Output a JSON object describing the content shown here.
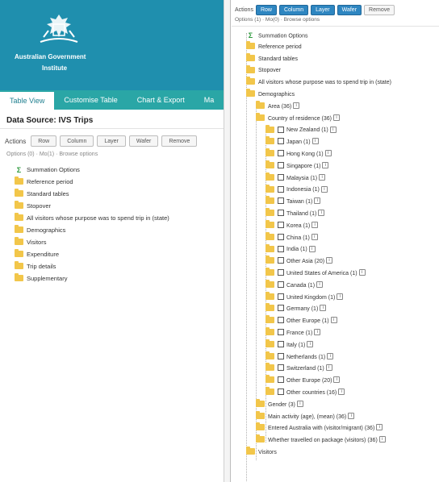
{
  "colors": {
    "banner": "#1f8fae",
    "tabbar": "#2aa6a6",
    "folder": "#f2c64a",
    "action_button": "#2e86c1"
  },
  "header": {
    "org_line1": "Australian Government",
    "org_line2": "Institute",
    "logo_icon": "coat-of-arms-icon"
  },
  "tabs": [
    {
      "label": "Table View",
      "active": true
    },
    {
      "label": "Customise Table",
      "active": false
    },
    {
      "label": "Chart & Export",
      "active": false
    },
    {
      "label": "Ma",
      "active": false
    }
  ],
  "left": {
    "data_source_title": "Data Source: IVS Trips",
    "actions_label": "Actions",
    "buttons": [
      "Row",
      "Column",
      "Layer",
      "Wafer",
      "Remove"
    ],
    "options_text": "Options (0) · Mo(1) · Browse options",
    "tree": [
      {
        "icon": "sigma-icon",
        "label": "Summation Options"
      },
      {
        "icon": "folder-icon",
        "label": "Reference period"
      },
      {
        "icon": "folder-icon",
        "label": "Standard tables"
      },
      {
        "icon": "folder-icon",
        "label": "Stopover"
      },
      {
        "icon": "folder-icon",
        "label": "All visitors whose purpose was to spend trip in (state)"
      },
      {
        "icon": "folder-icon",
        "label": "Demographics"
      },
      {
        "icon": "folder-icon",
        "label": "Visitors"
      },
      {
        "icon": "folder-icon",
        "label": "Expenditure"
      },
      {
        "icon": "folder-icon",
        "label": "Trip details"
      },
      {
        "icon": "folder-icon",
        "label": "Supplementary"
      }
    ]
  },
  "right": {
    "actions_label": "Actions",
    "buttons": [
      "Row",
      "Column",
      "Layer",
      "Wafer"
    ],
    "remove_label": "Remove",
    "options_text": "Options (1) · Mo(0) · Browse options",
    "tree": [
      {
        "type": "sigma",
        "depth": 0,
        "label": "Summation Options"
      },
      {
        "type": "folder",
        "depth": 0,
        "label": "Reference period"
      },
      {
        "type": "folder",
        "depth": 0,
        "label": "Standard tables"
      },
      {
        "type": "folder",
        "depth": 0,
        "label": "Stopover"
      },
      {
        "type": "folder",
        "depth": 0,
        "label": "All visitors whose purpose was to spend trip in (state)"
      },
      {
        "type": "folder",
        "depth": 0,
        "label": "Demographics"
      },
      {
        "type": "folder",
        "depth": 1,
        "label": "Area (36)",
        "info": true
      },
      {
        "type": "folder",
        "depth": 1,
        "label": "Country of residence (36)",
        "info": true
      },
      {
        "type": "folder-check",
        "depth": 2,
        "label": "New Zealand (1)",
        "info": true
      },
      {
        "type": "folder-check",
        "depth": 2,
        "label": "Japan (1)",
        "info": true
      },
      {
        "type": "folder-check",
        "depth": 2,
        "label": "Hong Kong (1)",
        "info": true
      },
      {
        "type": "folder-check",
        "depth": 2,
        "label": "Singapore (1)",
        "info": true
      },
      {
        "type": "folder-check",
        "depth": 2,
        "label": "Malaysia (1)",
        "info": true
      },
      {
        "type": "folder-check",
        "depth": 2,
        "label": "Indonesia (1)",
        "info": true
      },
      {
        "type": "folder-check",
        "depth": 2,
        "label": "Taiwan (1)",
        "info": true
      },
      {
        "type": "folder-check",
        "depth": 2,
        "label": "Thailand (1)",
        "info": true
      },
      {
        "type": "folder-check",
        "depth": 2,
        "label": "Korea (1)",
        "info": true
      },
      {
        "type": "folder-check",
        "depth": 2,
        "label": "China (1)",
        "info": true
      },
      {
        "type": "folder-check",
        "depth": 2,
        "label": "India (1)",
        "info": true
      },
      {
        "type": "folder-check",
        "depth": 2,
        "label": "Other Asia (20)",
        "info": true
      },
      {
        "type": "folder-check",
        "depth": 2,
        "label": "United States of America (1)",
        "info": true
      },
      {
        "type": "folder-check",
        "depth": 2,
        "label": "Canada (1)",
        "info": true
      },
      {
        "type": "folder-check",
        "depth": 2,
        "label": "United Kingdom (1)",
        "info": true
      },
      {
        "type": "folder-check",
        "depth": 2,
        "label": "Germany (1)",
        "info": true
      },
      {
        "type": "folder-check",
        "depth": 2,
        "label": "Other Europe (1)",
        "info": true
      },
      {
        "type": "folder-check",
        "depth": 2,
        "label": "France (1)",
        "info": true
      },
      {
        "type": "folder-check",
        "depth": 2,
        "label": "Italy (1)",
        "info": true
      },
      {
        "type": "folder-check",
        "depth": 2,
        "label": "Netherlands (1)",
        "info": true
      },
      {
        "type": "folder-check",
        "depth": 2,
        "label": "Switzerland (1)",
        "info": true
      },
      {
        "type": "folder-check",
        "depth": 2,
        "label": "Other Europe (20)",
        "info": true
      },
      {
        "type": "folder-check",
        "depth": 2,
        "label": "Other countries (16)",
        "info": true
      },
      {
        "type": "folder",
        "depth": 1,
        "label": "Gender (3)",
        "info": true
      },
      {
        "type": "folder",
        "depth": 1,
        "label": "Main activity (age), (mean) (36)",
        "info": true
      },
      {
        "type": "folder",
        "depth": 1,
        "label": "Entered Australia with (visitor/migrant) (36)",
        "info": true
      },
      {
        "type": "folder",
        "depth": 1,
        "label": "Whether travelled on package (visitors) (36)",
        "info": true
      },
      {
        "type": "folder",
        "depth": 0,
        "label": "Visitors"
      }
    ]
  }
}
